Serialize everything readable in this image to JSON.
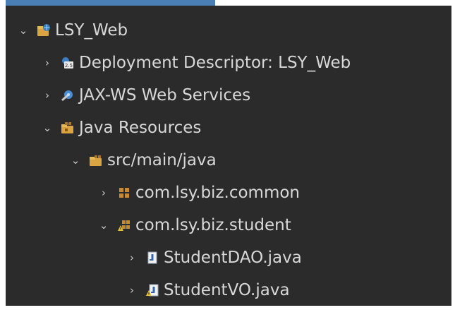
{
  "tree": {
    "root": {
      "label": "LSY_Web",
      "icon": "web-project-icon",
      "expanded": true
    },
    "deployment_descriptor": {
      "label": "Deployment Descriptor: LSY_Web",
      "icon": "deployment-descriptor-icon",
      "expanded": false
    },
    "jaxws": {
      "label": "JAX-WS Web Services",
      "icon": "web-services-icon",
      "expanded": false
    },
    "java_resources": {
      "label": "Java Resources",
      "icon": "java-resources-icon",
      "expanded": true
    },
    "src_main_java": {
      "label": "src/main/java",
      "icon": "source-folder-icon",
      "expanded": true
    },
    "pkg_common": {
      "label": "com.lsy.biz.common",
      "icon": "package-icon",
      "expanded": false
    },
    "pkg_student": {
      "label": "com.lsy.biz.student",
      "icon": "package-warning-icon",
      "expanded": true
    },
    "student_dao": {
      "label": "StudentDAO.java",
      "icon": "java-file-icon",
      "expanded": false
    },
    "student_vo": {
      "label": "StudentVO.java",
      "icon": "java-file-warning-icon",
      "expanded": false
    }
  },
  "glyphs": {
    "expanded": "⌄",
    "collapsed": "›"
  },
  "colors": {
    "background": "#2b2b2b",
    "text": "#d8d8d8",
    "selection_accent": "#4a7fb5"
  }
}
